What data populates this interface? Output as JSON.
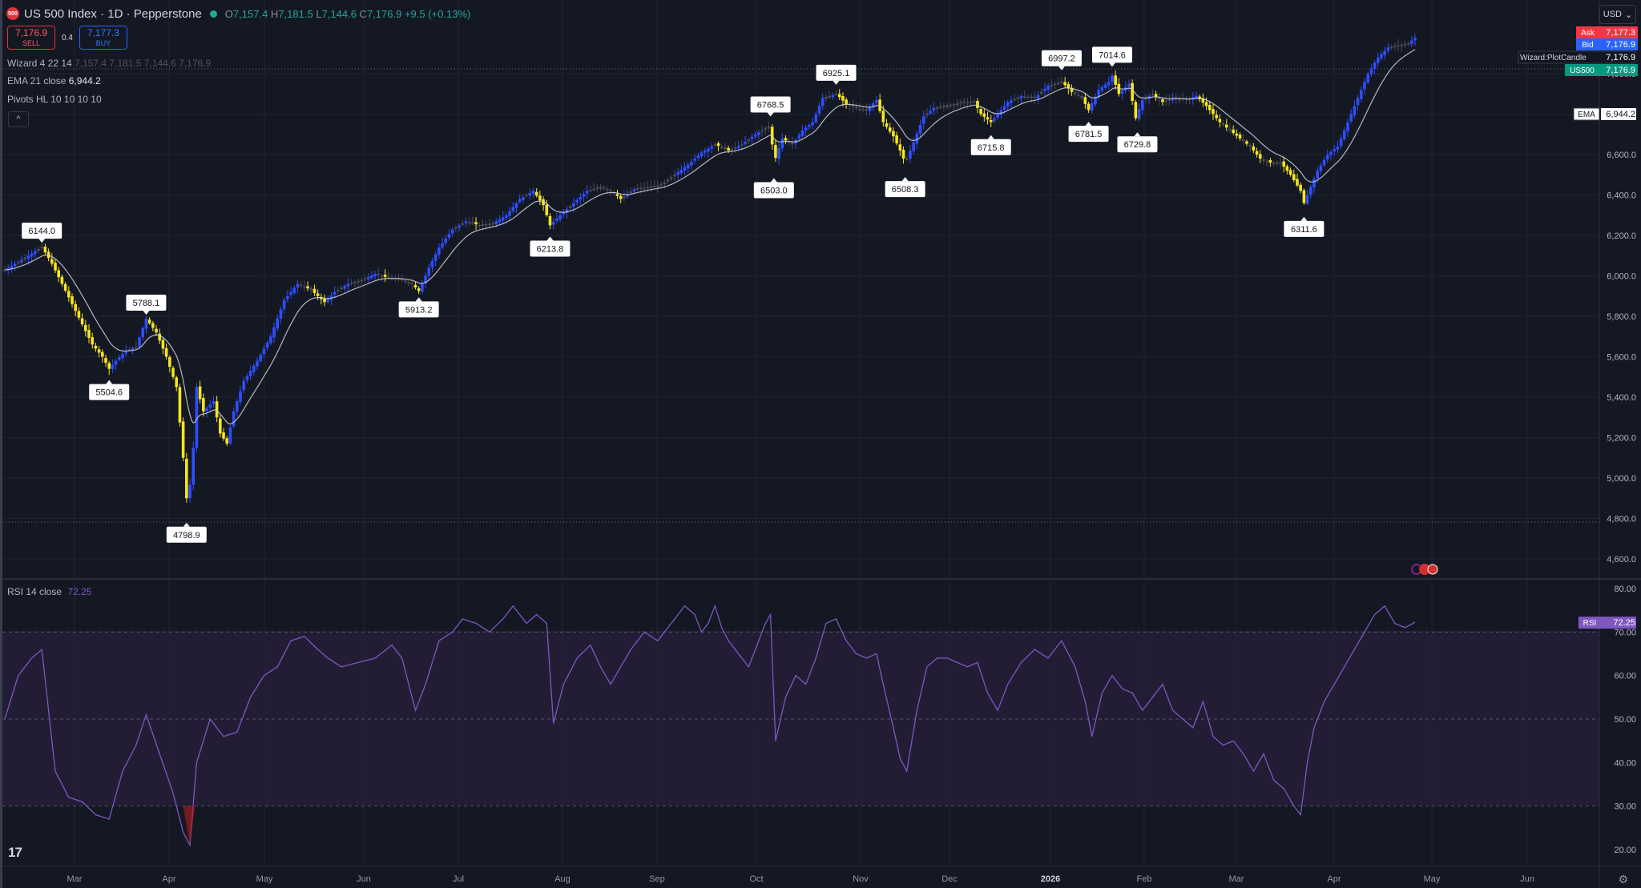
{
  "header": {
    "symbol": "US 500 Index · 1D · Pepperstone",
    "logo_text": "500",
    "o_label": "O",
    "o": "7,157.4",
    "h_label": "H",
    "h": "7,181.5",
    "l_label": "L",
    "l": "7,144.6",
    "c_label": "C",
    "c": "7,176.9",
    "change": "+9.5 (+0.13%)",
    "currency": "USD"
  },
  "trade": {
    "sell_price": "7,176.9",
    "sell_label": "SELL",
    "spread": "0.4",
    "buy_price": "7,177.3",
    "buy_label": "BUY"
  },
  "indicators": {
    "wizard": "Wizard 4 22 14",
    "wizard_values": "7,157.4  7,181.5  7,144.6  7,176.9",
    "ema": "EMA 21 close",
    "ema_value": "6,944.2",
    "pivots": "Pivots HL 10 10 10 10",
    "collapse": "^",
    "rsi": "RSI 14 close",
    "rsi_value": "72.25"
  },
  "colors": {
    "background": "#141823",
    "bull": "#2f4dff",
    "bear": "#f7e51e",
    "neutral": "#4a4e58",
    "ema": "#d1d4dc",
    "rsi": "#7e57c2",
    "grid": "#1f2330"
  },
  "price_scale_labels": [
    {
      "tag": "Ask",
      "value": "7,177.3",
      "color": "#f23645"
    },
    {
      "tag": "Bid",
      "value": "7,176.9",
      "color": "#2962ff"
    },
    {
      "tag": "Wizard:PlotCandle",
      "value": "7,176.9",
      "color": "#141823"
    },
    {
      "tag": "US500",
      "value": "7,176.9",
      "color": "#089981"
    },
    {
      "tag": "EMA",
      "value": "6,944.2",
      "color": "#ffffff"
    }
  ],
  "rsi_badge": {
    "tag": "RSI",
    "value": "72.25"
  },
  "chart_data": {
    "type": "candlestick",
    "price_axis": {
      "ylim": [
        4500,
        7200
      ],
      "ticks": [
        "7,000.0",
        "6,800.0",
        "6,600.0",
        "6,400.0",
        "6,200.0",
        "6,000.0",
        "5,800.0",
        "5,600.0",
        "5,400.0",
        "5,200.0",
        "5,000.0",
        "4,800.0",
        "4,600.0"
      ]
    },
    "time_axis": [
      "Mar",
      "Apr",
      "May",
      "Jun",
      "Jul",
      "Aug",
      "Sep",
      "Oct",
      "Nov",
      "Dec",
      "2026",
      "Feb",
      "Mar",
      "Apr",
      "May",
      "Jun"
    ],
    "pivots": [
      {
        "label": "6144.0",
        "type": "high",
        "bar": 22
      },
      {
        "label": "5504.6",
        "type": "low",
        "bar": 62
      },
      {
        "label": "5788.1",
        "type": "high",
        "bar": 84
      },
      {
        "label": "4798.9",
        "type": "low",
        "bar": 108
      },
      {
        "label": "5913.2",
        "type": "low",
        "bar": 246
      },
      {
        "label": "6213.8",
        "type": "low",
        "bar": 324
      },
      {
        "label": "6768.5",
        "type": "high",
        "bar": 455
      },
      {
        "label": "6503.0",
        "type": "low",
        "bar": 457
      },
      {
        "label": "6925.1",
        "type": "high",
        "bar": 494
      },
      {
        "label": "6508.3",
        "type": "low",
        "bar": 535
      },
      {
        "label": "6715.8",
        "type": "low",
        "bar": 586
      },
      {
        "label": "6997.2",
        "type": "high",
        "bar": 628
      },
      {
        "label": "6781.5",
        "type": "low",
        "bar": 644
      },
      {
        "label": "7014.6",
        "type": "high",
        "bar": 658
      },
      {
        "label": "6729.8",
        "type": "low",
        "bar": 673
      },
      {
        "label": "6311.6",
        "type": "low",
        "bar": 772
      }
    ],
    "close_path": [
      [
        0,
        6030
      ],
      [
        6,
        6060
      ],
      [
        14,
        6100
      ],
      [
        22,
        6144
      ],
      [
        28,
        6060
      ],
      [
        34,
        5960
      ],
      [
        40,
        5860
      ],
      [
        46,
        5760
      ],
      [
        52,
        5660
      ],
      [
        58,
        5600
      ],
      [
        62,
        5540
      ],
      [
        66,
        5580
      ],
      [
        72,
        5630
      ],
      [
        78,
        5650
      ],
      [
        84,
        5788
      ],
      [
        90,
        5720
      ],
      [
        96,
        5600
      ],
      [
        102,
        5450
      ],
      [
        106,
        5100
      ],
      [
        108,
        4900
      ],
      [
        111,
        5000
      ],
      [
        114,
        5450
      ],
      [
        118,
        5330
      ],
      [
        124,
        5380
      ],
      [
        128,
        5220
      ],
      [
        132,
        5170
      ],
      [
        136,
        5330
      ],
      [
        142,
        5480
      ],
      [
        150,
        5580
      ],
      [
        158,
        5700
      ],
      [
        166,
        5880
      ],
      [
        174,
        5960
      ],
      [
        182,
        5930
      ],
      [
        190,
        5870
      ],
      [
        196,
        5920
      ],
      [
        204,
        5960
      ],
      [
        212,
        5980
      ],
      [
        220,
        6010
      ],
      [
        228,
        5990
      ],
      [
        236,
        5980
      ],
      [
        242,
        5960
      ],
      [
        246,
        5925
      ],
      [
        252,
        6040
      ],
      [
        258,
        6140
      ],
      [
        266,
        6230
      ],
      [
        274,
        6270
      ],
      [
        282,
        6250
      ],
      [
        290,
        6260
      ],
      [
        298,
        6300
      ],
      [
        306,
        6380
      ],
      [
        314,
        6420
      ],
      [
        320,
        6350
      ],
      [
        324,
        6250
      ],
      [
        330,
        6300
      ],
      [
        338,
        6360
      ],
      [
        346,
        6420
      ],
      [
        354,
        6440
      ],
      [
        362,
        6410
      ],
      [
        366,
        6380
      ],
      [
        374,
        6430
      ],
      [
        382,
        6440
      ],
      [
        390,
        6450
      ],
      [
        398,
        6500
      ],
      [
        406,
        6550
      ],
      [
        414,
        6610
      ],
      [
        422,
        6650
      ],
      [
        430,
        6620
      ],
      [
        438,
        6650
      ],
      [
        446,
        6700
      ],
      [
        452,
        6730
      ],
      [
        455,
        6740
      ],
      [
        457,
        6560
      ],
      [
        462,
        6680
      ],
      [
        468,
        6650
      ],
      [
        474,
        6720
      ],
      [
        480,
        6760
      ],
      [
        486,
        6880
      ],
      [
        494,
        6900
      ],
      [
        500,
        6850
      ],
      [
        506,
        6830
      ],
      [
        512,
        6820
      ],
      [
        518,
        6870
      ],
      [
        522,
        6760
      ],
      [
        528,
        6690
      ],
      [
        532,
        6620
      ],
      [
        535,
        6560
      ],
      [
        540,
        6660
      ],
      [
        546,
        6790
      ],
      [
        552,
        6830
      ],
      [
        558,
        6840
      ],
      [
        564,
        6850
      ],
      [
        570,
        6860
      ],
      [
        576,
        6860
      ],
      [
        580,
        6800
      ],
      [
        586,
        6760
      ],
      [
        590,
        6800
      ],
      [
        596,
        6860
      ],
      [
        604,
        6890
      ],
      [
        612,
        6880
      ],
      [
        620,
        6940
      ],
      [
        628,
        6960
      ],
      [
        634,
        6910
      ],
      [
        640,
        6880
      ],
      [
        644,
        6820
      ],
      [
        650,
        6920
      ],
      [
        656,
        6960
      ],
      [
        658,
        6990
      ],
      [
        662,
        6900
      ],
      [
        668,
        6950
      ],
      [
        672,
        6780
      ],
      [
        676,
        6870
      ],
      [
        682,
        6900
      ],
      [
        688,
        6860
      ],
      [
        694,
        6880
      ],
      [
        702,
        6870
      ],
      [
        708,
        6890
      ],
      [
        714,
        6840
      ],
      [
        718,
        6800
      ],
      [
        722,
        6760
      ],
      [
        728,
        6720
      ],
      [
        734,
        6680
      ],
      [
        740,
        6640
      ],
      [
        746,
        6580
      ],
      [
        752,
        6560
      ],
      [
        758,
        6560
      ],
      [
        764,
        6500
      ],
      [
        770,
        6420
      ],
      [
        772,
        6360
      ],
      [
        776,
        6440
      ],
      [
        780,
        6520
      ],
      [
        786,
        6600
      ],
      [
        792,
        6640
      ],
      [
        798,
        6760
      ],
      [
        804,
        6880
      ],
      [
        810,
        7000
      ],
      [
        816,
        7080
      ],
      [
        822,
        7130
      ],
      [
        828,
        7140
      ],
      [
        834,
        7150
      ],
      [
        838,
        7177
      ]
    ],
    "rsi_axis": {
      "ylim": [
        20,
        80
      ],
      "ticks": [
        "80.00",
        "70.00",
        "60.00",
        "50.00",
        "40.00",
        "30.00",
        "20.00"
      ],
      "bands": [
        30,
        70
      ]
    },
    "rsi_path": [
      [
        0,
        50
      ],
      [
        8,
        60
      ],
      [
        16,
        64
      ],
      [
        22,
        66
      ],
      [
        30,
        38
      ],
      [
        38,
        32
      ],
      [
        46,
        31
      ],
      [
        54,
        28
      ],
      [
        62,
        27
      ],
      [
        70,
        38
      ],
      [
        78,
        44
      ],
      [
        84,
        51
      ],
      [
        92,
        42
      ],
      [
        100,
        33
      ],
      [
        106,
        24
      ],
      [
        110,
        21
      ],
      [
        114,
        40
      ],
      [
        122,
        50
      ],
      [
        130,
        46
      ],
      [
        138,
        47
      ],
      [
        146,
        55
      ],
      [
        154,
        60
      ],
      [
        162,
        62
      ],
      [
        170,
        68
      ],
      [
        178,
        69
      ],
      [
        186,
        66
      ],
      [
        192,
        64
      ],
      [
        200,
        62
      ],
      [
        210,
        63
      ],
      [
        220,
        64
      ],
      [
        230,
        67
      ],
      [
        236,
        64
      ],
      [
        244,
        52
      ],
      [
        250,
        58
      ],
      [
        258,
        68
      ],
      [
        266,
        70
      ],
      [
        272,
        73
      ],
      [
        280,
        72
      ],
      [
        288,
        70
      ],
      [
        296,
        73
      ],
      [
        302,
        76
      ],
      [
        310,
        72
      ],
      [
        316,
        74
      ],
      [
        322,
        72
      ],
      [
        326,
        49
      ],
      [
        332,
        58
      ],
      [
        340,
        64
      ],
      [
        348,
        67
      ],
      [
        354,
        62
      ],
      [
        360,
        58
      ],
      [
        366,
        62
      ],
      [
        372,
        66
      ],
      [
        380,
        70
      ],
      [
        388,
        68
      ],
      [
        396,
        72
      ],
      [
        404,
        76
      ],
      [
        410,
        74
      ],
      [
        414,
        70
      ],
      [
        418,
        72
      ],
      [
        422,
        76
      ],
      [
        426,
        71
      ],
      [
        430,
        68
      ],
      [
        436,
        65
      ],
      [
        442,
        62
      ],
      [
        448,
        68
      ],
      [
        452,
        72
      ],
      [
        455,
        74
      ],
      [
        458,
        45
      ],
      [
        464,
        55
      ],
      [
        470,
        60
      ],
      [
        476,
        58
      ],
      [
        482,
        64
      ],
      [
        488,
        72
      ],
      [
        494,
        73
      ],
      [
        500,
        68
      ],
      [
        506,
        65
      ],
      [
        512,
        64
      ],
      [
        518,
        65
      ],
      [
        522,
        58
      ],
      [
        528,
        48
      ],
      [
        532,
        41
      ],
      [
        536,
        38
      ],
      [
        542,
        52
      ],
      [
        548,
        62
      ],
      [
        554,
        64
      ],
      [
        560,
        64
      ],
      [
        566,
        63
      ],
      [
        572,
        62
      ],
      [
        578,
        63
      ],
      [
        584,
        56
      ],
      [
        590,
        52
      ],
      [
        596,
        58
      ],
      [
        604,
        63
      ],
      [
        612,
        66
      ],
      [
        620,
        64
      ],
      [
        628,
        68
      ],
      [
        636,
        62
      ],
      [
        642,
        54
      ],
      [
        646,
        46
      ],
      [
        652,
        56
      ],
      [
        658,
        60
      ],
      [
        664,
        57
      ],
      [
        670,
        56
      ],
      [
        676,
        52
      ],
      [
        682,
        55
      ],
      [
        688,
        58
      ],
      [
        694,
        52
      ],
      [
        700,
        50
      ],
      [
        706,
        48
      ],
      [
        712,
        54
      ],
      [
        718,
        46
      ],
      [
        724,
        44
      ],
      [
        730,
        45
      ],
      [
        736,
        42
      ],
      [
        742,
        38
      ],
      [
        748,
        42
      ],
      [
        754,
        36
      ],
      [
        760,
        34
      ],
      [
        766,
        30
      ],
      [
        770,
        28
      ],
      [
        774,
        40
      ],
      [
        778,
        48
      ],
      [
        784,
        54
      ],
      [
        790,
        58
      ],
      [
        796,
        62
      ],
      [
        802,
        66
      ],
      [
        808,
        70
      ],
      [
        814,
        74
      ],
      [
        820,
        76
      ],
      [
        826,
        72
      ],
      [
        832,
        71
      ],
      [
        838,
        72.25
      ]
    ]
  }
}
